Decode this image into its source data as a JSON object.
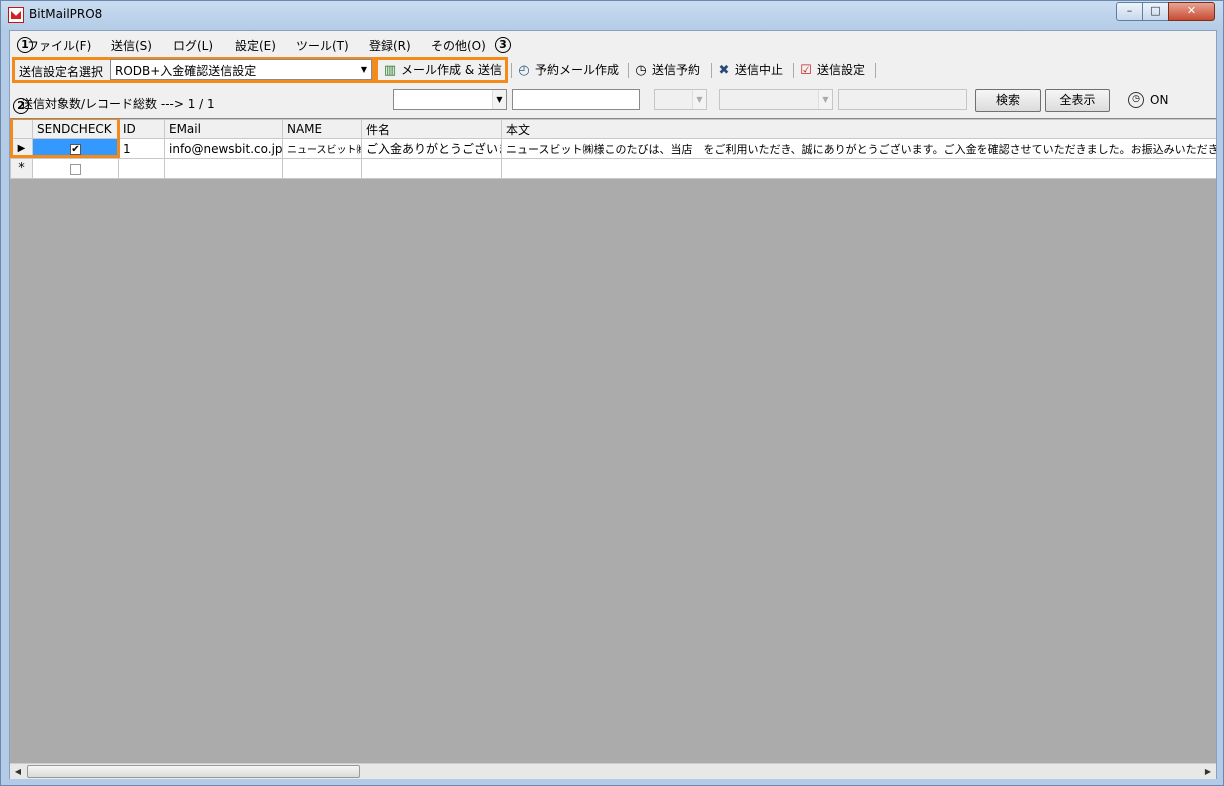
{
  "window": {
    "title": "BitMailPRO8",
    "min": "–",
    "max": "□",
    "close": "✕"
  },
  "menu": {
    "items": [
      "ファイル(F)",
      "送信(S)",
      "ログ(L)",
      "設定(E)",
      "ツール(T)",
      "登録(R)",
      "その他(O)"
    ],
    "markers": [
      "1",
      "2",
      "3"
    ]
  },
  "toolbar": {
    "profile_label": "送信設定名選択",
    "profile_value": "RODB+入金確認送信設定",
    "compose_send": "メール作成 & 送信",
    "scheduled_compose": "予約メール作成",
    "schedule_send": "送信予約",
    "stop_send": "送信中止",
    "send_settings": "送信設定"
  },
  "filterbar": {
    "record_count": "送信対象数/レコード総数 ---> 1 / 1",
    "search_button": "検索",
    "show_all_button": "全表示",
    "on_label": "ON"
  },
  "grid": {
    "columns": [
      "SENDCHECK",
      "ID",
      "EMail",
      "NAME",
      "件名",
      "本文"
    ],
    "rows": [
      {
        "sendcheck": true,
        "id": "1",
        "email": "info@newsbit.co.jp",
        "name": "ニュースビット㈱",
        "subject": "ご入金ありがとうございました",
        "body": "ニュースビット㈱様このたびは、当店　をご利用いただき、誠にありがとうございます。ご入金を確認させていただきました。お振込みいただきまして、誠にありがとう"
      }
    ],
    "new_row_marker": "*"
  },
  "colors": {
    "highlight": "#f28a1c",
    "selection": "#3399ff"
  }
}
